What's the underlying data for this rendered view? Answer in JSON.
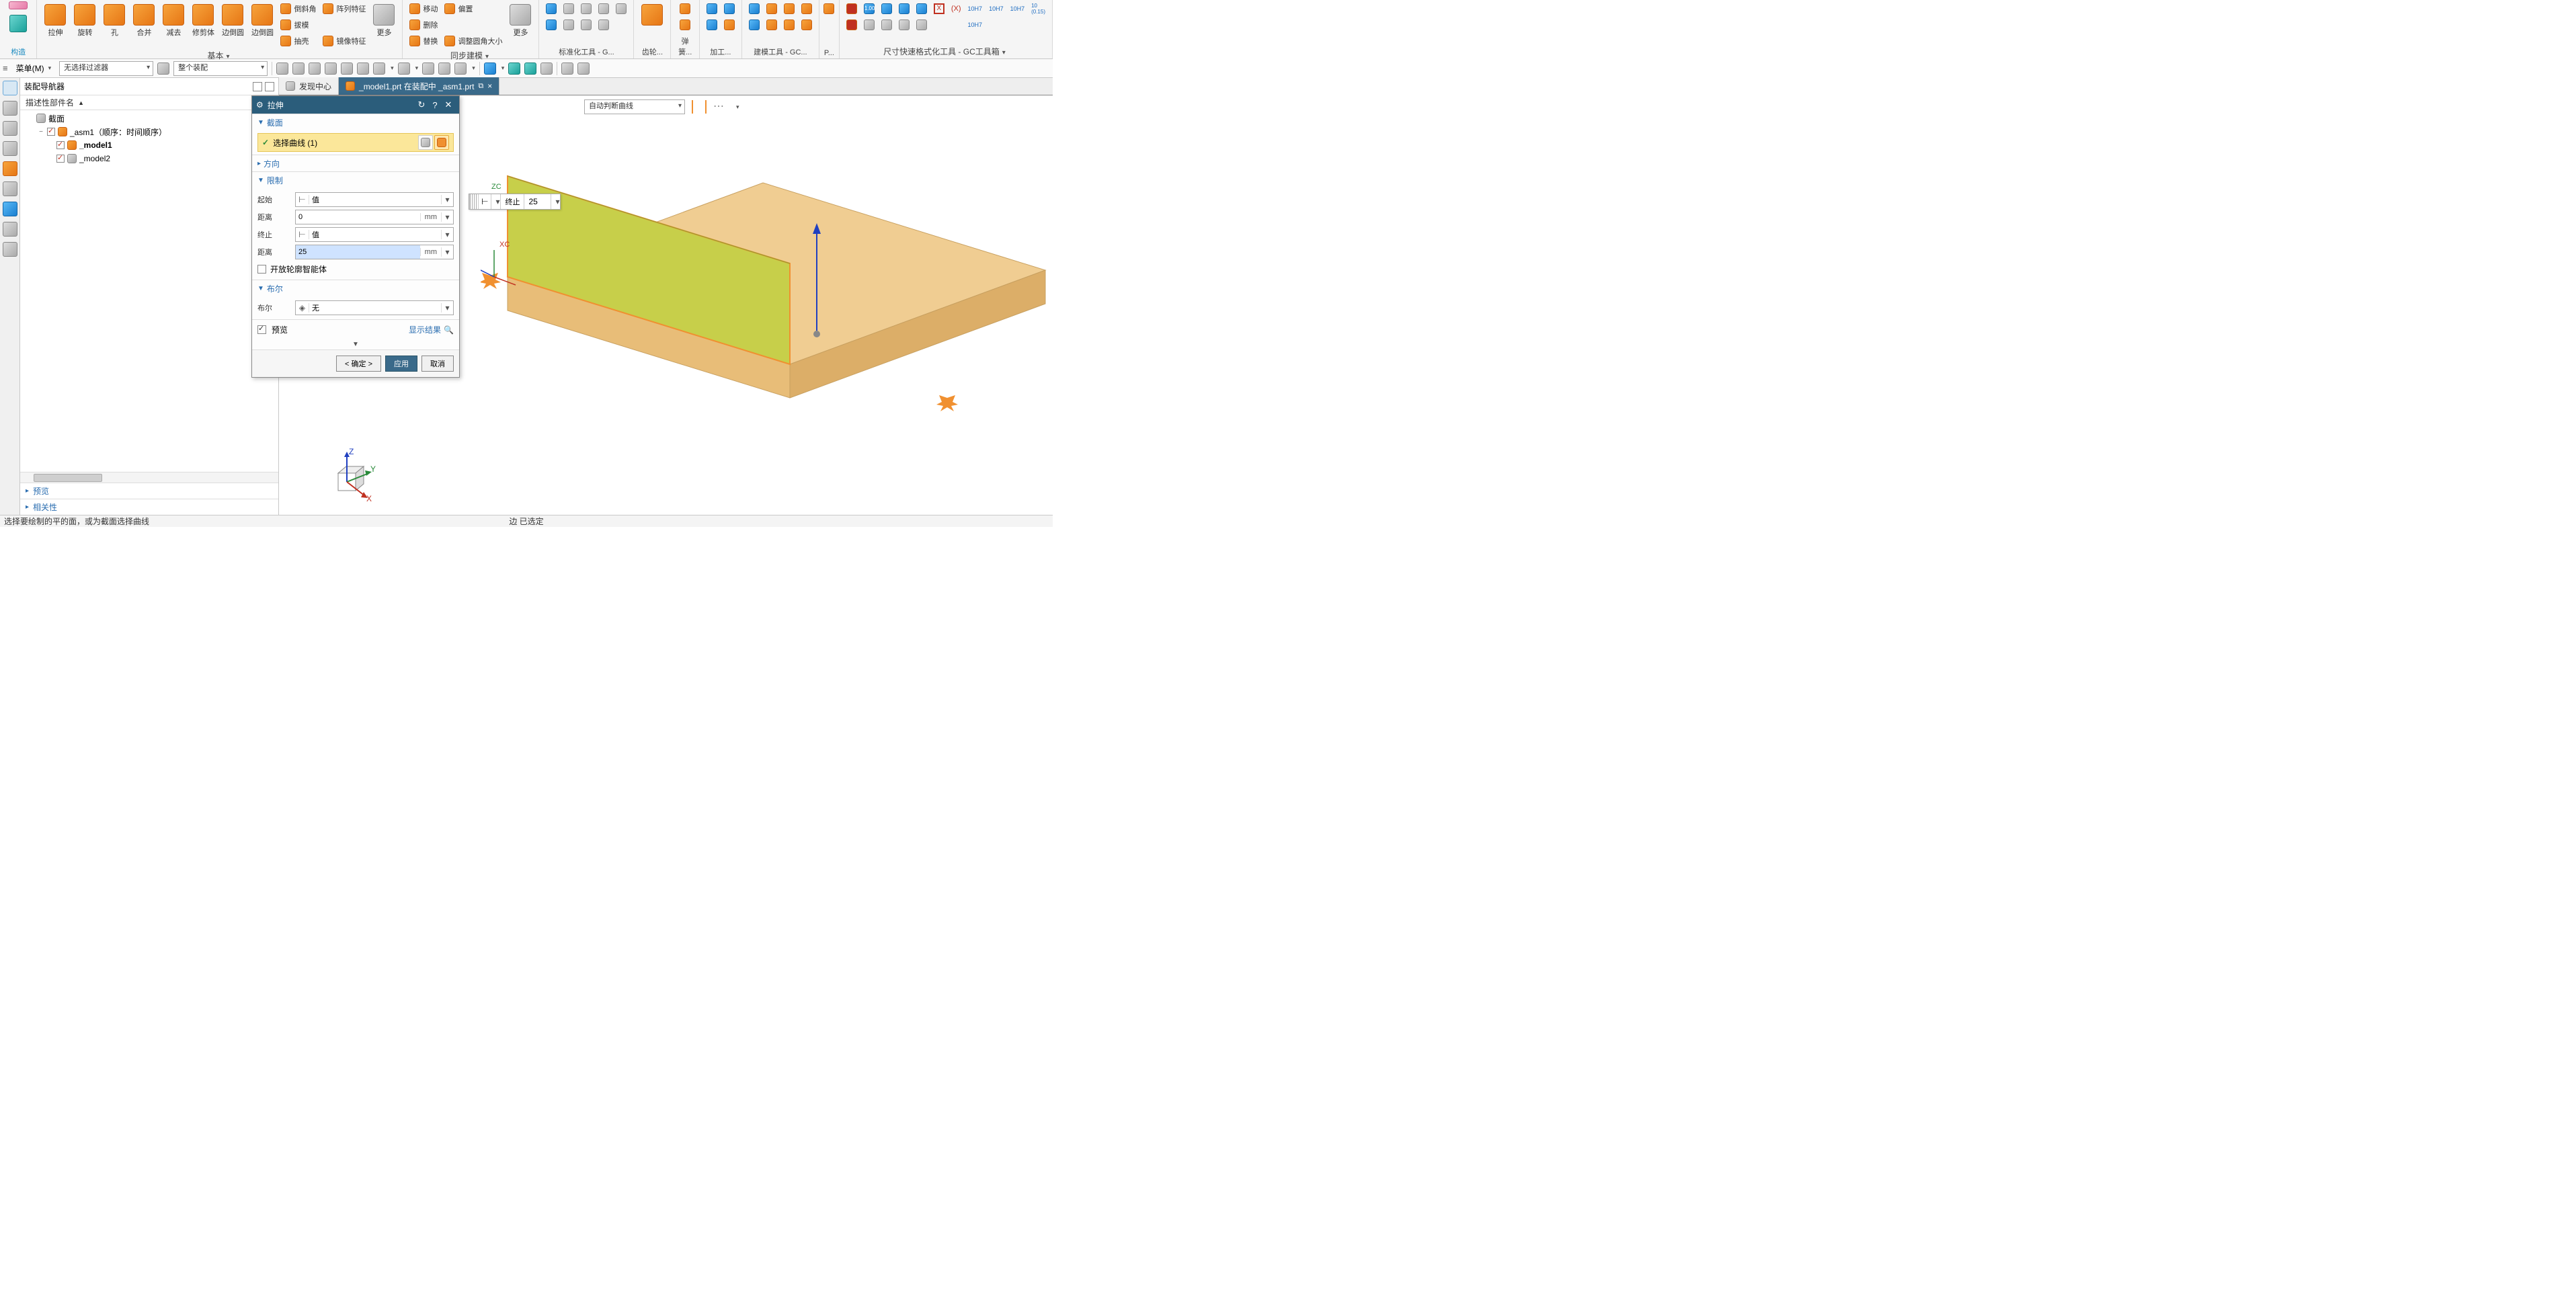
{
  "ribbon": {
    "construct_label": "构造",
    "groups": {
      "basic": {
        "label": "基本",
        "items": [
          "拉伸",
          "旋转",
          "孔",
          "合并",
          "减去",
          "修剪体",
          "边倒圆",
          "边倒圆",
          "更多"
        ],
        "small": [
          "倒斜角",
          "拔模",
          "抽壳",
          "阵列特征",
          "镜像特征"
        ]
      },
      "sync": {
        "label": "同步建模",
        "items": [
          "更多",
          "偏置",
          "调整圆角大小"
        ],
        "small": [
          "移动",
          "删除",
          "替换"
        ]
      },
      "std": {
        "label": "标准化工具 - G..."
      },
      "gear": {
        "label": "齿轮..."
      },
      "spring": {
        "label": "弹簧..."
      },
      "machining": {
        "label": "加工..."
      },
      "modeling": {
        "label": "建模工具 - GC..."
      },
      "p": {
        "label": "P..."
      },
      "dim": {
        "label": "尺寸快速格式化工具 - GC工具箱"
      }
    }
  },
  "toolbar2": {
    "menu": "菜单(M)",
    "filter1": "无选择过滤器",
    "filter2": "整个装配"
  },
  "nav": {
    "title": "装配导航器",
    "col": "描述性部件名",
    "nodes": {
      "section": "截面",
      "asm": "_asm1（顺序：时间顺序）",
      "m1": "_model1",
      "m2": "_model2"
    },
    "preview": "预览",
    "related": "相关性"
  },
  "tabs": {
    "discover": "发现中心",
    "doc": "_model1.prt 在装配中 _asm1.prt"
  },
  "vp": {
    "curve_mode": "自动判断曲线",
    "inline_label": "终止",
    "inline_value": "25",
    "zc": "ZC",
    "xc": "XC",
    "tri_x": "X",
    "tri_y": "Y",
    "tri_z": "Z"
  },
  "dialog": {
    "title": "拉伸",
    "sec_section": "截面",
    "select_curve": "选择曲线 (1)",
    "sec_dir": "方向",
    "sec_limit": "限制",
    "start": "起始",
    "value_opt": "值",
    "distance": "距离",
    "start_dist": "0",
    "end": "终止",
    "end_dist": "25",
    "unit": "mm",
    "open_profile": "开放轮廓智能体",
    "sec_bool": "布尔",
    "bool_label": "布尔",
    "bool_none": "无",
    "preview": "预览",
    "show_result": "显示结果",
    "ok": "< 确定 >",
    "apply": "应用",
    "cancel": "取消"
  },
  "status": {
    "left": "选择要绘制的平的面，或为截面选择曲线",
    "mid": "边 已选定"
  }
}
